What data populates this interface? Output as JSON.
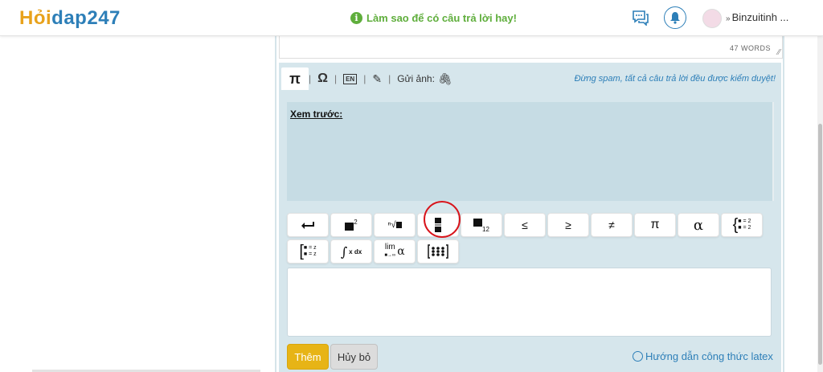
{
  "header": {
    "logo_part1": "Hỏi",
    "logo_part2": "dap247",
    "hint": "Làm sao để có câu trả lời hay!",
    "hint_icon": "info-icon",
    "username": "Binzuitinh ..."
  },
  "editor": {
    "word_count": "47 WORDS"
  },
  "toolbar": {
    "tabs": [
      "π",
      "Ω",
      "EN",
      "✎"
    ],
    "send_image_label": "Gửi ảnh:",
    "notice": "Đừng spam, tất cả câu trả lời đều được kiểm duyệt!"
  },
  "preview": {
    "label": "Xem trước:"
  },
  "math_buttons": {
    "row1": [
      {
        "name": "newline",
        "label": "↵"
      },
      {
        "name": "superscript",
        "label": "x²"
      },
      {
        "name": "sqrt",
        "label": "√"
      },
      {
        "name": "fraction",
        "label": "frac"
      },
      {
        "name": "subscript",
        "label": "x₁₂"
      },
      {
        "name": "leq",
        "label": "≤"
      },
      {
        "name": "geq",
        "label": "≥"
      },
      {
        "name": "neq",
        "label": "≠"
      },
      {
        "name": "pi",
        "label": "π"
      },
      {
        "name": "alpha",
        "label": "α"
      },
      {
        "name": "system",
        "label": "{ }"
      }
    ],
    "row2": [
      {
        "name": "bracket-system",
        "label": "[ ]"
      },
      {
        "name": "integral",
        "label": "∫ x dx"
      },
      {
        "name": "limit",
        "label": "lim α"
      },
      {
        "name": "matrix",
        "label": "matrix"
      }
    ]
  },
  "actions": {
    "add": "Thêm",
    "cancel": "Hủy bỏ",
    "guide": "Hướng dẫn công thức latex"
  }
}
